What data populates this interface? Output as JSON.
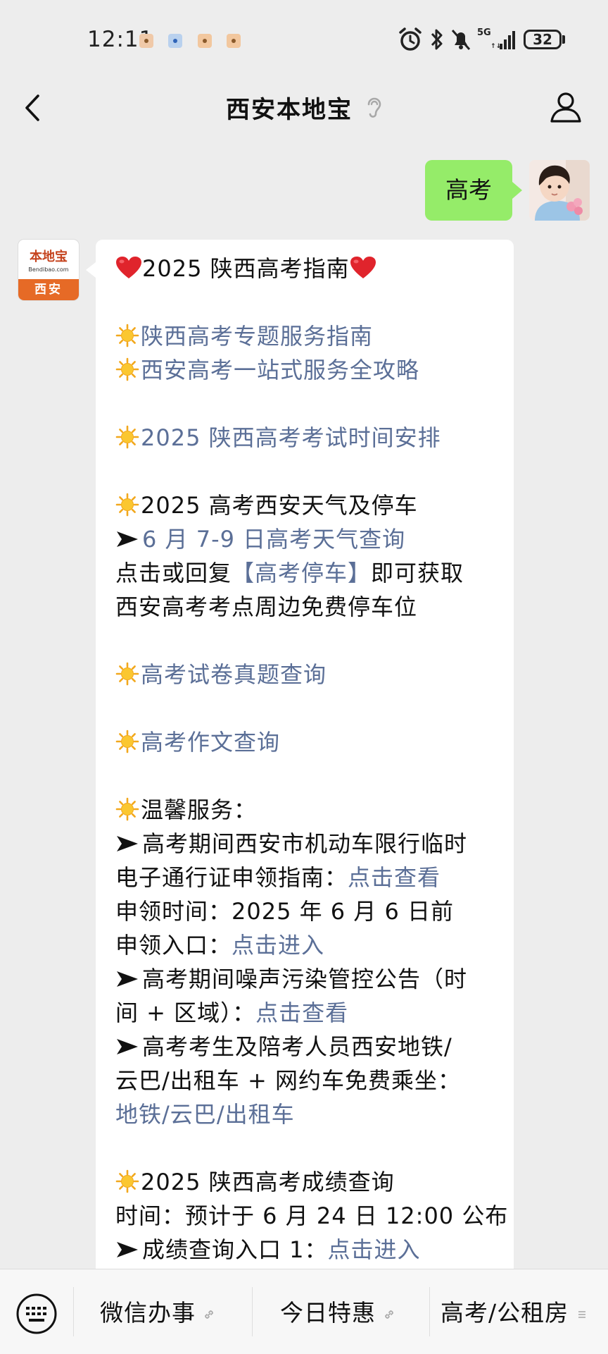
{
  "status_bar": {
    "time": "12:11",
    "network": "5G",
    "battery": "32"
  },
  "header": {
    "title": "西安本地宝"
  },
  "chat": {
    "outgoing_message": "高考",
    "brand_avatar": {
      "top": "本地宝",
      "middle": "Bendibao.com",
      "bottom": "西安"
    },
    "reply": {
      "title": "2025 陕西高考指南",
      "l_service_guide": "陕西高考专题服务指南",
      "l_one_stop": "西安高考一站式服务全攻略",
      "l_exam_schedule": "2025 陕西高考考试时间安排",
      "weather_heading": "2025 高考西安天气及停车",
      "l_weather_query": "6 月 7-9 日高考天气查询",
      "parking_pre": "点击或回复",
      "parking_link": "【高考停车】",
      "parking_post": "即可获取",
      "parking_line2": "西安高考考点周边免费停车位",
      "l_exam_papers": "高考试卷真题查询",
      "l_essay": "高考作文查询",
      "warm_service": "温馨服务：",
      "vehicle_line1": "高考期间西安市机动车限行临时",
      "vehicle_line2": "电子通行证申领指南：",
      "vehicle_link": "点击查看",
      "apply_time": "申领时间：2025 年 6 月 6 日前",
      "apply_entry": "申领入口：",
      "apply_link": "点击进入",
      "noise_line1": "高考期间噪声污染管控公告（时",
      "noise_line2": "间 + 区域）：",
      "noise_link": "点击查看",
      "transit_line1": "高考考生及陪考人员西安地铁/",
      "transit_line2": "云巴/出租车 + 网约车免费乘坐：",
      "metro": "地铁",
      "sep1": "/",
      "cloudbus": "云巴",
      "sep2": "/",
      "taxi": "出租车",
      "score_heading": "2025 陕西高考成绩查询",
      "score_time": "时间：预计于 6 月 24 日 12:00 公布",
      "score_entry": "成绩查询入口 1：",
      "score_link": "点击进入"
    }
  },
  "bottom_menu": {
    "items": [
      "微信办事",
      "今日特惠",
      "高考/公租房"
    ]
  },
  "colors": {
    "outgoing_bubble": "#95ec69",
    "link": "#5b6f97",
    "brand_orange": "#e66a26",
    "background": "#ededed"
  },
  "icons": [
    "back-arrow-icon",
    "ear-icon",
    "profile-icon",
    "heart-icon",
    "sun-icon",
    "arrow-right-icon",
    "keyboard-icon",
    "link-icon",
    "menu-lines-icon"
  ]
}
